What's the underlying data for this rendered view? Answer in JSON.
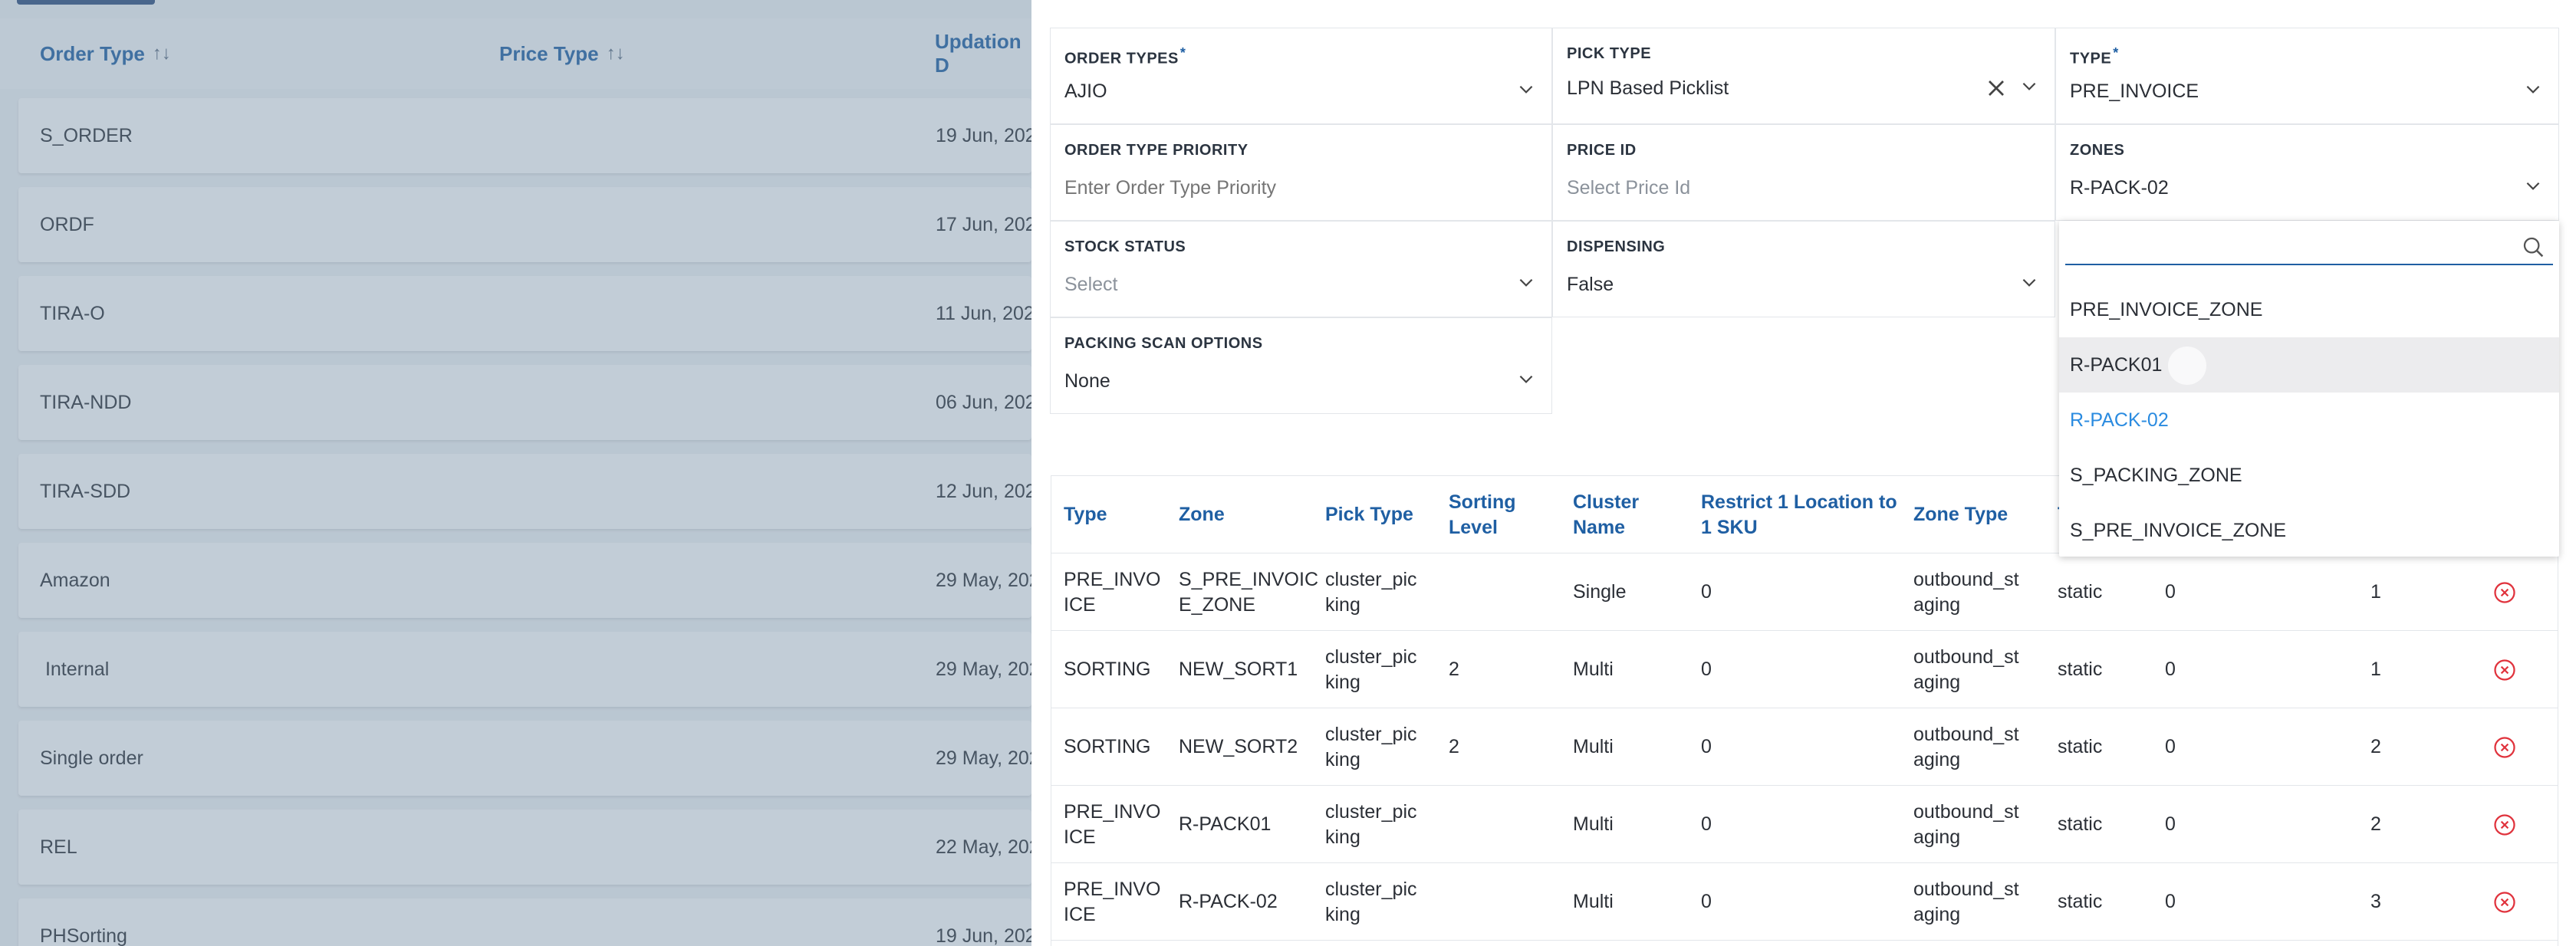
{
  "background_list": {
    "headers": {
      "order_type": "Order Type",
      "price_type": "Price Type",
      "updation_date": "Updation D"
    },
    "sort_icon": "↑↓",
    "rows": [
      {
        "order_type": "S_ORDER",
        "date": "19 Jun, 202"
      },
      {
        "order_type": "ORDF",
        "date": "17 Jun, 202"
      },
      {
        "order_type": "TIRA-O",
        "date": "11 Jun, 202"
      },
      {
        "order_type": "TIRA-NDD",
        "date": "06 Jun, 202"
      },
      {
        "order_type": "TIRA-SDD",
        "date": "12 Jun, 202"
      },
      {
        "order_type": "Amazon",
        "date": "29 May, 202"
      },
      {
        "order_type": " Internal",
        "date": "29 May, 202"
      },
      {
        "order_type": "Single order",
        "date": "29 May, 202"
      },
      {
        "order_type": "REL",
        "date": "22 May, 202"
      },
      {
        "order_type": "PHSorting",
        "date": "19 Jun, 202"
      }
    ]
  },
  "form": {
    "order_types": {
      "label": "ORDER TYPES",
      "required": "*",
      "value": "AJIO"
    },
    "pick_type": {
      "label": "PICK TYPE",
      "value": "LPN Based Picklist"
    },
    "type": {
      "label": "TYPE",
      "required": "*",
      "value": "PRE_INVOICE"
    },
    "order_type_priority": {
      "label": "ORDER TYPE PRIORITY",
      "placeholder": "Enter Order Type Priority"
    },
    "price_id": {
      "label": "PRICE ID",
      "placeholder": "Select Price Id"
    },
    "zones": {
      "label": "ZONES",
      "value": "R-PACK-02"
    },
    "stock_status": {
      "label": "STOCK STATUS",
      "placeholder": "Select"
    },
    "dispensing": {
      "label": "DISPENSING",
      "value": "False"
    },
    "packing_scan_options": {
      "label": "PACKING SCAN OPTIONS",
      "value": "None"
    }
  },
  "zones_dropdown": {
    "search_value": "",
    "options": [
      "PRE_INVOICE_ZONE",
      "R-PACK01",
      "R-PACK-02",
      "S_PACKING_ZONE",
      "S_PRE_INVOICE_ZONE"
    ],
    "hovered": "R-PACK01",
    "selected": "R-PACK-02"
  },
  "zone_table": {
    "headers": [
      "Type",
      "Zone",
      "Pick Type",
      "Sorting Level",
      "Cluster Name",
      "Restrict 1 Location to 1 SKU",
      "Zone Type",
      "T"
    ],
    "rows": [
      {
        "type": "PRE_INVO ICE",
        "zone": "S_PRE_INVOIC E_ZONE",
        "pick_type": "cluster_pic king",
        "sorting_level": "",
        "cluster_name": "Single",
        "restrict": "0",
        "zone_type": "outbound_st aging",
        "col8": "static",
        "col9": "0",
        "col10": "1"
      },
      {
        "type": "SORTING",
        "zone": "NEW_SORT1",
        "pick_type": "cluster_pic king",
        "sorting_level": "2",
        "cluster_name": "Multi",
        "restrict": "0",
        "zone_type": "outbound_st aging",
        "col8": "static",
        "col9": "0",
        "col10": "1"
      },
      {
        "type": "SORTING",
        "zone": "NEW_SORT2",
        "pick_type": "cluster_pic king",
        "sorting_level": "2",
        "cluster_name": "Multi",
        "restrict": "0",
        "zone_type": "outbound_st aging",
        "col8": "static",
        "col9": "0",
        "col10": "2"
      },
      {
        "type": "PRE_INVO ICE",
        "zone": "R-PACK01",
        "pick_type": "cluster_pic king",
        "sorting_level": "",
        "cluster_name": "Multi",
        "restrict": "0",
        "zone_type": "outbound_st aging",
        "col8": "static",
        "col9": "0",
        "col10": "2"
      },
      {
        "type": "PRE_INVO ICE",
        "zone": "R-PACK-02",
        "pick_type": "cluster_pic king",
        "sorting_level": "",
        "cluster_name": "Multi",
        "restrict": "0",
        "zone_type": "outbound_st aging",
        "col8": "static",
        "col9": "0",
        "col10": "3"
      }
    ]
  },
  "colors": {
    "accent": "#1f5fa3",
    "selected_option": "#2a8be0",
    "delete_icon": "#e0323c",
    "overlay": "#6e87a0"
  },
  "icons": {
    "chevron": "chevron-down-icon",
    "clear": "close-icon",
    "search": "search-icon",
    "delete": "remove-circle-icon",
    "sort": "sort-icon"
  }
}
